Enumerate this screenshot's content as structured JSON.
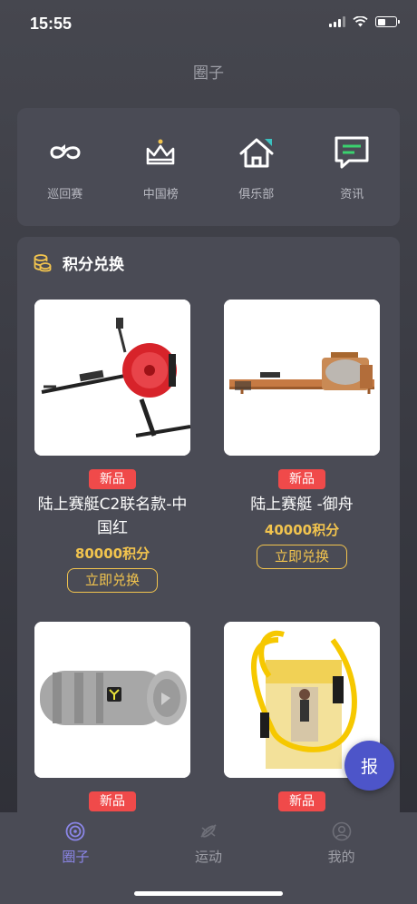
{
  "status": {
    "time": "15:55"
  },
  "page": {
    "title": "圈子"
  },
  "quick_nav": [
    {
      "label": "巡回赛",
      "icon": "tour-loop-icon"
    },
    {
      "label": "中国榜",
      "icon": "crown-icon"
    },
    {
      "label": "俱乐部",
      "icon": "home-icon"
    },
    {
      "label": "资讯",
      "icon": "news-chat-icon"
    }
  ],
  "exchange": {
    "title": "积分兑换",
    "products": [
      {
        "badge": "新品",
        "name": "陆上赛艇C2联名款-中国红",
        "points": "80000积分",
        "button": "立即兑换"
      },
      {
        "badge": "新品",
        "name": "陆上赛艇 -御舟",
        "points": "40000积分",
        "button": "立即兑换"
      },
      {
        "badge": "新品"
      },
      {
        "badge": "新品"
      }
    ]
  },
  "float_button": {
    "label": "报"
  },
  "tabs": [
    {
      "label": "圈子",
      "icon": "circle-target-icon",
      "active": true
    },
    {
      "label": "运动",
      "icon": "rowing-icon",
      "active": false
    },
    {
      "label": "我的",
      "icon": "user-icon",
      "active": false
    }
  ],
  "colors": {
    "accent": "#8b86e8",
    "points": "#f2c44e",
    "badge": "#f04a4a",
    "float": "#4d55c9"
  }
}
